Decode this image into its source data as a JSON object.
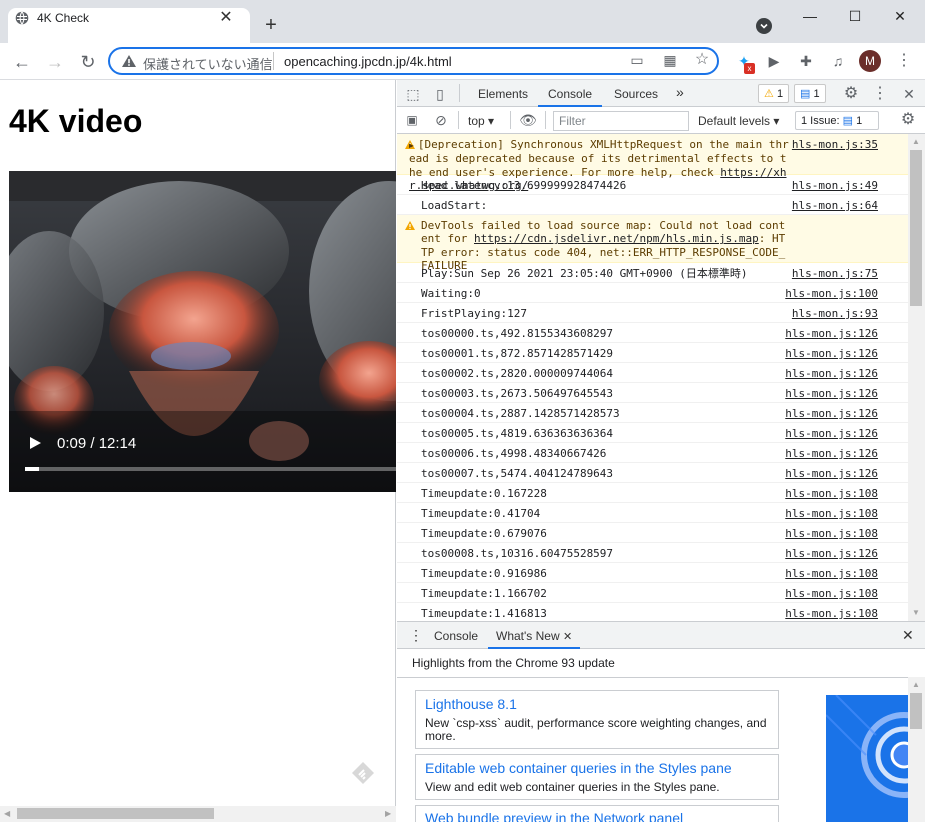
{
  "browser": {
    "tab_title": "4K Check",
    "security_text": "保護されていない通信",
    "url": "opencaching.jpcdn.jp/4k.html",
    "avatar_letter": "M"
  },
  "page": {
    "heading": "4K video",
    "video": {
      "time": "0:09 / 12:14",
      "progress_fraction": 0.012
    }
  },
  "devtools": {
    "tabs": [
      "Elements",
      "Console",
      "Sources"
    ],
    "active_tab": "Console",
    "warnings_count": "1",
    "messages_count": "1",
    "context": "top",
    "filter_placeholder": "Filter",
    "levels": "Default levels",
    "issues_label": "1 Issue:",
    "issues_count": "1",
    "console_rows": [
      {
        "type": "warn",
        "msg": "[Deprecation] Synchronous XMLHttpRequest on the main thread is deprecated because of its detrimental effects to the end user's experience. For more help, check ",
        "link": "https://xhr.spec.whatwg.org/",
        "tail": ".",
        "src": "hls-mon.js:35"
      },
      {
        "type": "log",
        "msg": "Head latency:13.699999928474426",
        "src": "hls-mon.js:49"
      },
      {
        "type": "log",
        "msg": "LoadStart:",
        "src": "hls-mon.js:64"
      },
      {
        "type": "warn",
        "msg": "DevTools failed to load source map: Could not load content for ",
        "link": "https://cdn.jsdelivr.net/npm/hls.min.js.map",
        "tail": ": HTTP error: status code 404, net::ERR_HTTP_RESPONSE_CODE_FAILURE",
        "src": ""
      },
      {
        "type": "log",
        "msg": "Play:Sun Sep 26 2021 23:05:40 GMT+0900 (日本標準時)",
        "src": "hls-mon.js:75"
      },
      {
        "type": "log",
        "msg": "Waiting:0",
        "src": "hls-mon.js:100"
      },
      {
        "type": "log",
        "msg": "FristPlaying:127",
        "src": "hls-mon.js:93"
      },
      {
        "type": "log",
        "msg": "tos00000.ts,492.8155343608297",
        "src": "hls-mon.js:126"
      },
      {
        "type": "log",
        "msg": "tos00001.ts,872.8571428571429",
        "src": "hls-mon.js:126"
      },
      {
        "type": "log",
        "msg": "tos00002.ts,2820.000009744064",
        "src": "hls-mon.js:126"
      },
      {
        "type": "log",
        "msg": "tos00003.ts,2673.506497645543",
        "src": "hls-mon.js:126"
      },
      {
        "type": "log",
        "msg": "tos00004.ts,2887.1428571428573",
        "src": "hls-mon.js:126"
      },
      {
        "type": "log",
        "msg": "tos00005.ts,4819.636363636364",
        "src": "hls-mon.js:126"
      },
      {
        "type": "log",
        "msg": "tos00006.ts,4998.48340667426",
        "src": "hls-mon.js:126"
      },
      {
        "type": "log",
        "msg": "tos00007.ts,5474.404124789643",
        "src": "hls-mon.js:126"
      },
      {
        "type": "log",
        "msg": "Timeupdate:0.167228",
        "src": "hls-mon.js:108"
      },
      {
        "type": "log",
        "msg": "Timeupdate:0.41704",
        "src": "hls-mon.js:108"
      },
      {
        "type": "log",
        "msg": "Timeupdate:0.679076",
        "src": "hls-mon.js:108"
      },
      {
        "type": "log",
        "msg": "tos00008.ts,10316.60475528597",
        "src": "hls-mon.js:126"
      },
      {
        "type": "log",
        "msg": "Timeupdate:0.916986",
        "src": "hls-mon.js:108"
      },
      {
        "type": "log",
        "msg": "Timeupdate:1.166702",
        "src": "hls-mon.js:108"
      },
      {
        "type": "log",
        "msg": "Timeupdate:1.416813",
        "src": "hls-mon.js:108"
      }
    ],
    "drawer": {
      "tabs": [
        "Console",
        "What's New"
      ],
      "active_tab": "What's New",
      "highlights": "Highlights from the Chrome 93 update",
      "cards": [
        {
          "title": "Lighthouse 8.1",
          "desc": "New `csp-xss` audit, performance score weighting changes, and more."
        },
        {
          "title": "Editable web container queries in the Styles pane",
          "desc": "View and edit web container queries in the Styles pane."
        },
        {
          "title": "Web bundle preview in the Network panel",
          "desc": ""
        }
      ]
    }
  },
  "colors": {
    "accent": "#1a73e8",
    "warn_bg": "#fffbe5",
    "warn_icon": "#f2a600"
  }
}
